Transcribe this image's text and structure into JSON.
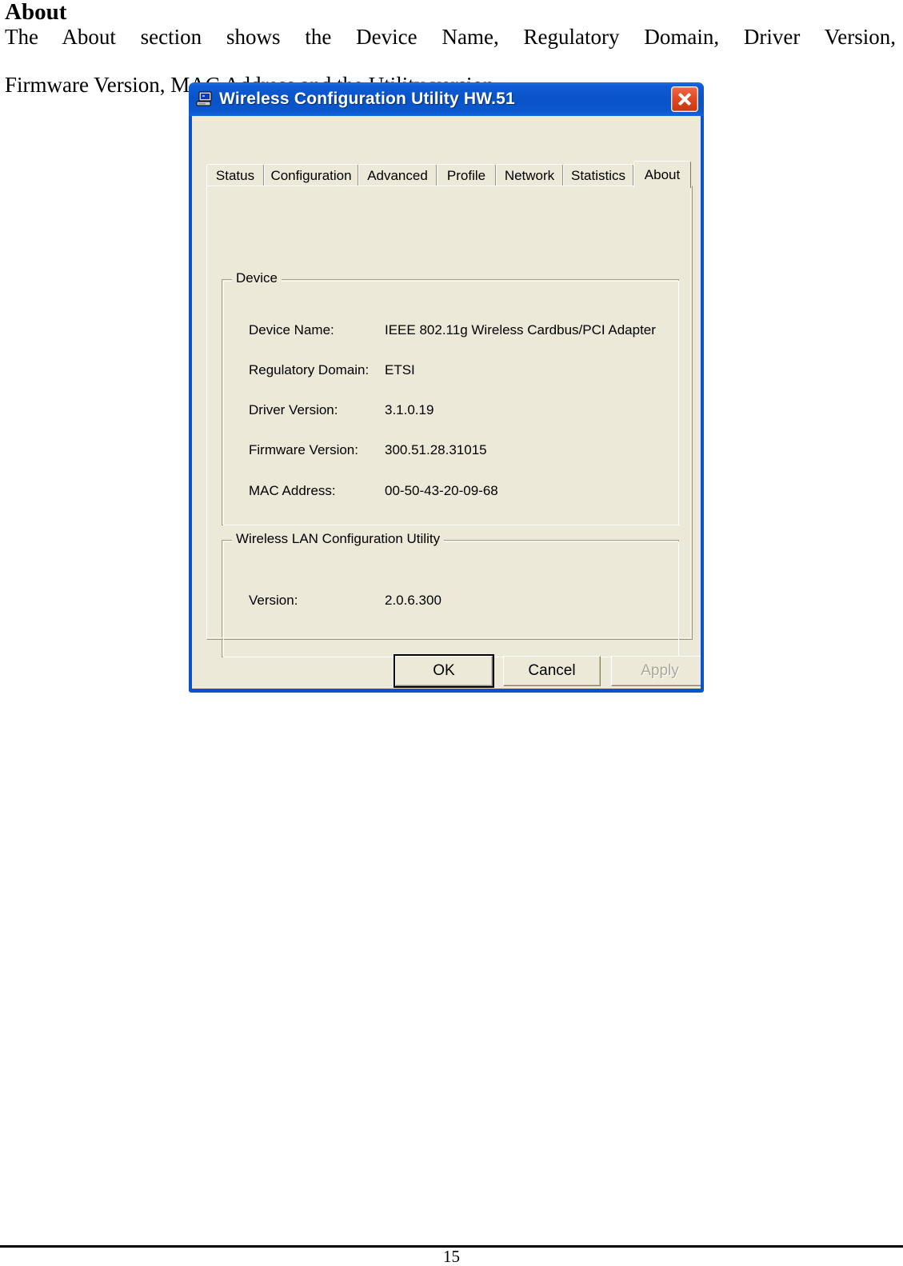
{
  "document": {
    "heading": "About",
    "paragraph_line1": "The About section shows the Device Name, Regulatory Domain, Driver Version,",
    "paragraph_line2": "Firmware Version, MAC Address and the Utility version.",
    "page_number": "15"
  },
  "window": {
    "title": "Wireless Configuration Utility HW.51",
    "icon": "computer-icon",
    "close_label": "×",
    "titlebar_color": "#0a53c8",
    "body_color": "#ece9d8"
  },
  "tabs": [
    {
      "label": "Status",
      "active": false
    },
    {
      "label": "Configuration",
      "active": false
    },
    {
      "label": "Advanced",
      "active": false
    },
    {
      "label": "Profile",
      "active": false
    },
    {
      "label": "Network",
      "active": false
    },
    {
      "label": "Statistics",
      "active": false
    },
    {
      "label": "About",
      "active": true
    }
  ],
  "groups": [
    {
      "title": "Device",
      "fields": [
        {
          "label": "Device Name:",
          "value": "IEEE 802.11g Wireless Cardbus/PCI Adapter"
        },
        {
          "label": "Regulatory Domain:",
          "value": "ETSI"
        },
        {
          "label": "Driver Version:",
          "value": "3.1.0.19"
        },
        {
          "label": "Firmware Version:",
          "value": "300.51.28.31015"
        },
        {
          "label": "MAC Address:",
          "value": "00-50-43-20-09-68"
        }
      ]
    },
    {
      "title": "Wireless LAN Configuration Utility",
      "fields": [
        {
          "label": "Version:",
          "value": "2.0.6.300"
        }
      ]
    }
  ],
  "buttons": [
    {
      "label": "OK",
      "state": "default"
    },
    {
      "label": "Cancel",
      "state": "normal"
    },
    {
      "label": "Apply",
      "state": "disabled"
    }
  ]
}
